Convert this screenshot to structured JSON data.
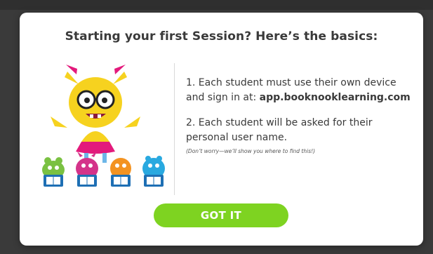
{
  "modal": {
    "title": "Starting your first Session? Here’s the basics:",
    "step1_text": "1. Each student must use their own device and sign in at: ",
    "step1_url": "app.booknooklearning.com",
    "step2_text": "2. Each student will be asked for their personal user name.",
    "note": "(Don’t worry—we’ll show you where to find this!)",
    "button_label": "GOT IT"
  },
  "colors": {
    "accent_green": "#7ed321",
    "title_text": "#3a3a3a",
    "overlay": "#3a3a3a"
  },
  "illustration": {
    "characters": [
      "yellow-monster-with-glasses",
      "green-monster-with-book",
      "pink-monster-with-book",
      "orange-monster-with-book",
      "blue-monster-with-book"
    ]
  }
}
